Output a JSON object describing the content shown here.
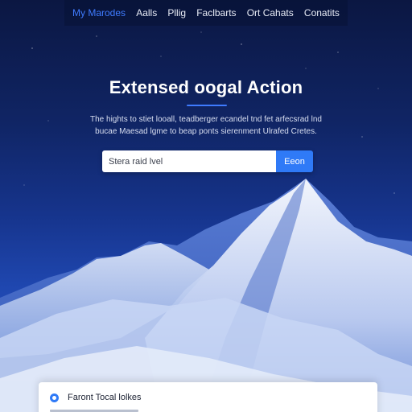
{
  "nav": {
    "items": [
      {
        "label": "My Marodes",
        "active": true
      },
      {
        "label": "Aalls",
        "active": false
      },
      {
        "label": "Pllig",
        "active": false
      },
      {
        "label": "Faclbarts",
        "active": false
      },
      {
        "label": "Ort Cahats",
        "active": false
      },
      {
        "label": "Conatits",
        "active": false
      }
    ]
  },
  "hero": {
    "title": "Extensed oogal Action",
    "subtitle_line1": "The hights to stiet looall, teadberger ecandel tnd fet arfecsrad lnd",
    "subtitle_line2": "bucae Maesad lgme to beap ponts sierenment Ulrafed Cretes."
  },
  "search": {
    "placeholder": "Stera raid lvel",
    "button_label": "Eeon"
  },
  "card": {
    "title": "Faront Tocal lolkes"
  },
  "colors": {
    "accent": "#3f7bff",
    "button": "#2f7af7",
    "sky_top": "#0b1742",
    "sky_bottom": "#2d5ac4"
  },
  "icons": {
    "card": "location-pin-icon"
  }
}
